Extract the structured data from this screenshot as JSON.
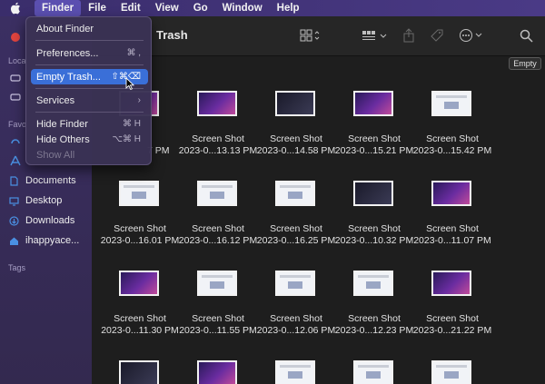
{
  "menubar": {
    "apple_icon": "apple-logo-icon",
    "items": [
      {
        "label": "Finder"
      },
      {
        "label": "File"
      },
      {
        "label": "Edit"
      },
      {
        "label": "View"
      },
      {
        "label": "Go"
      },
      {
        "label": "Window"
      },
      {
        "label": "Help"
      }
    ]
  },
  "finder_menu": {
    "items": [
      {
        "label": "About Finder",
        "shortcut": ""
      },
      {
        "label": "Preferences...",
        "shortcut": "⌘ ,"
      },
      {
        "label": "Empty Trash...",
        "shortcut": "⇧⌘⌫",
        "highlighted": true
      },
      {
        "label": "Services",
        "shortcut": "›"
      },
      {
        "label": "Hide Finder",
        "shortcut": "⌘ H"
      },
      {
        "label": "Hide Others",
        "shortcut": "⌥⌘ H"
      },
      {
        "label": "Show All",
        "shortcut": "",
        "disabled": true
      }
    ]
  },
  "sidebar": {
    "headings": {
      "locations": "Loca",
      "favorites": "Favo",
      "tags": "Tags"
    },
    "items": [
      {
        "label": "Documents",
        "icon": "document-icon"
      },
      {
        "label": "Desktop",
        "icon": "desktop-icon"
      },
      {
        "label": "Downloads",
        "icon": "downloads-icon"
      },
      {
        "label": "ihappyace...",
        "icon": "home-icon"
      }
    ]
  },
  "window": {
    "title": "Trash",
    "empty_button": "Empty",
    "toolbar_icons": [
      "view-grid-icon",
      "group-icon",
      "share-icon",
      "tag-icon",
      "more-icon",
      "search-icon"
    ]
  },
  "files": [
    {
      "line1": "",
      "line2": "7 PM",
      "kind": "purple"
    },
    {
      "line1": "Screen Shot",
      "line2": "2023-0...13.13 PM",
      "kind": "purple"
    },
    {
      "line1": "Screen Shot",
      "line2": "2023-0...14.58 PM",
      "kind": "dark"
    },
    {
      "line1": "Screen Shot",
      "line2": "2023-0...15.21 PM",
      "kind": "purple"
    },
    {
      "line1": "Screen Shot",
      "line2": "2023-0...15.42 PM",
      "kind": "light"
    },
    {
      "line1": "Screen Shot",
      "line2": "2023-0...16.01 PM",
      "kind": "light"
    },
    {
      "line1": "Screen Shot",
      "line2": "2023-0...16.12 PM",
      "kind": "light"
    },
    {
      "line1": "Screen Shot",
      "line2": "2023-0...16.25 PM",
      "kind": "light"
    },
    {
      "line1": "Screen Shot",
      "line2": "2023-0...10.32 PM",
      "kind": "dark"
    },
    {
      "line1": "Screen Shot",
      "line2": "2023-0...11.07 PM",
      "kind": "purple"
    },
    {
      "line1": "Screen Shot",
      "line2": "2023-0...11.30 PM",
      "kind": "purple"
    },
    {
      "line1": "Screen Shot",
      "line2": "2023-0...11.55 PM",
      "kind": "light"
    },
    {
      "line1": "Screen Shot",
      "line2": "2023-0...12.06 PM",
      "kind": "light"
    },
    {
      "line1": "Screen Shot",
      "line2": "2023-0...12.23 PM",
      "kind": "light"
    },
    {
      "line1": "Screen Shot",
      "line2": "2023-0...21.22 PM",
      "kind": "purple"
    },
    {
      "line1": "",
      "line2": "",
      "kind": "dark"
    },
    {
      "line1": "",
      "line2": "",
      "kind": "purple"
    },
    {
      "line1": "",
      "line2": "",
      "kind": "light"
    },
    {
      "line1": "",
      "line2": "",
      "kind": "light"
    },
    {
      "line1": "",
      "line2": "",
      "kind": "light"
    }
  ]
}
